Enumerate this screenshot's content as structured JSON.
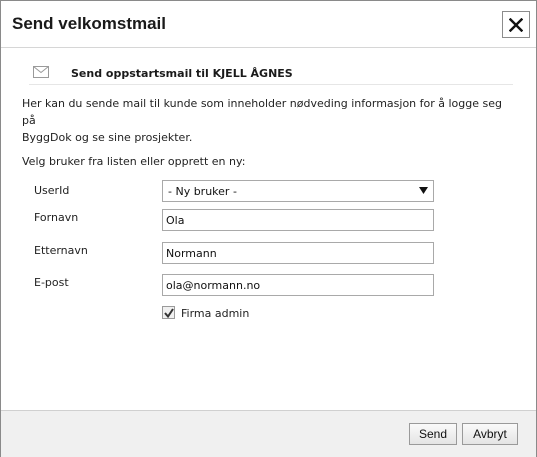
{
  "dialog": {
    "title": "Send velkomstmail",
    "close_icon": "close-icon"
  },
  "section": {
    "icon": "envelope-icon",
    "title": "Send oppstartsmail til KJELL ÅGNES"
  },
  "intro_line1": "Her kan du sende mail til kunde som inneholder nødveding informasjon for å logge seg på",
  "intro_line2": "ByggDok og se sine prosjekter.",
  "prompt": "Velg bruker fra listen eller opprett en ny:",
  "form": {
    "userid_label": "UserId",
    "userid_value": "- Ny bruker -",
    "firstname_label": "Fornavn",
    "firstname_value": "Ola",
    "lastname_label": "Etternavn",
    "lastname_value": "Normann",
    "email_label": "E-post",
    "email_value": "ola@normann.no",
    "admin_label": "Firma admin",
    "admin_checked": true
  },
  "footer": {
    "send_label": "Send",
    "cancel_label": "Avbryt"
  }
}
